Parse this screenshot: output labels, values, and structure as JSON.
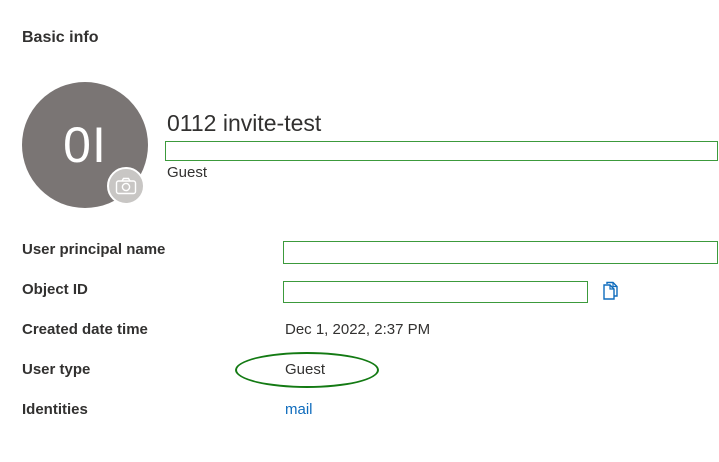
{
  "section": {
    "title": "Basic info"
  },
  "profile": {
    "initials": "0I",
    "display_name": "0112 invite-test",
    "user_type": "Guest",
    "avatar_color": "#7a7574",
    "camera_icon": "camera-icon"
  },
  "fields": {
    "upn_label": "User principal name",
    "oid_label": "Object ID",
    "created_label": "Created date time",
    "created_value": "Dec 1, 2022, 2:37 PM",
    "usertype_label": "User type",
    "usertype_value": "Guest",
    "identities_label": "Identities",
    "identities_value": "mail",
    "copy_icon": "copy-icon"
  },
  "colors": {
    "redaction_box": "#3c9a3c",
    "highlight_ellipse": "#137a13",
    "link": "#0f6cbd"
  }
}
